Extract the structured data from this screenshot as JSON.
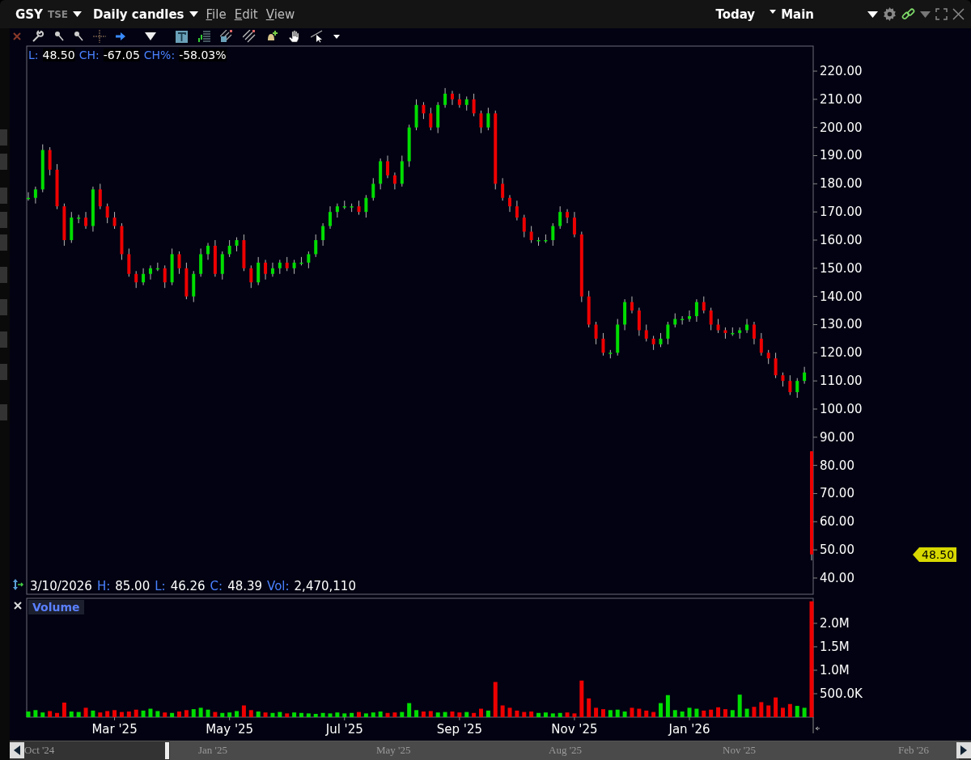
{
  "header": {
    "symbol": "GSY",
    "exchange": "TSE",
    "bar_type": "Daily candles",
    "menus": [
      "File",
      "Edit",
      "View"
    ],
    "period": "Today",
    "layout": "Main"
  },
  "price_legend": [
    {
      "label": "L:",
      "value": "48.50"
    },
    {
      "label": "CH:",
      "value": "-67.05"
    },
    {
      "label": "CH%:",
      "value": "-58.03%"
    }
  ],
  "price_chart": {
    "chart_data": {
      "type": "candlestick",
      "ylim": [
        34.24,
        228.9
      ],
      "yticks": [
        {
          "value": 40,
          "label": "40.00"
        },
        {
          "value": 50,
          "label": "50.00"
        },
        {
          "value": 60,
          "label": "60.00"
        },
        {
          "value": 70,
          "label": "70.00"
        },
        {
          "value": 80,
          "label": "80.00"
        },
        {
          "value": 90,
          "label": "90.00"
        },
        {
          "value": 100,
          "label": "100.00"
        },
        {
          "value": 110,
          "label": "110.00"
        },
        {
          "value": 120,
          "label": "120.00"
        },
        {
          "value": 130,
          "label": "130.00"
        },
        {
          "value": 140,
          "label": "140.00"
        },
        {
          "value": 150,
          "label": "150.00"
        },
        {
          "value": 160,
          "label": "160.00"
        },
        {
          "value": 170,
          "label": "170.00"
        },
        {
          "value": 180,
          "label": "180.00"
        },
        {
          "value": 190,
          "label": "190.00"
        },
        {
          "value": 200,
          "label": "200.00"
        },
        {
          "value": 210,
          "label": "210.00"
        },
        {
          "value": 220,
          "label": "220.00"
        }
      ],
      "categories": [
        null,
        null,
        null,
        null,
        null,
        null,
        null,
        null,
        null,
        null,
        null,
        null,
        null,
        null,
        null,
        null,
        null,
        null,
        null,
        null,
        null,
        null,
        null,
        null,
        null,
        null,
        null,
        null,
        null,
        null,
        null,
        null,
        null,
        null,
        null,
        null,
        null,
        null,
        null,
        null,
        null,
        null,
        null,
        null,
        null,
        null,
        null,
        null,
        null,
        null,
        null,
        null,
        null,
        null,
        null,
        null,
        null,
        null,
        null,
        null,
        null,
        null,
        null,
        null,
        null,
        null,
        null,
        null,
        null,
        null,
        null,
        null,
        null,
        null,
        null,
        null,
        null,
        null,
        null,
        null,
        null,
        null,
        null,
        null,
        null,
        null,
        null,
        null,
        null,
        null,
        null,
        null,
        null,
        null,
        null,
        null,
        null,
        null,
        null,
        null,
        null,
        null,
        null,
        null,
        null,
        null,
        null,
        null,
        null,
        null
      ],
      "ohlc": [
        [
          175,
          177,
          174,
          175
        ],
        [
          175,
          179,
          173,
          178
        ],
        [
          178,
          194,
          177,
          192
        ],
        [
          192,
          193,
          183,
          185
        ],
        [
          185,
          187,
          171,
          172
        ],
        [
          172,
          173,
          158,
          160
        ],
        [
          160,
          170,
          159,
          168
        ],
        [
          168,
          169,
          166,
          168
        ],
        [
          168,
          170,
          164,
          165
        ],
        [
          165,
          179,
          163,
          178
        ],
        [
          178,
          180,
          171,
          172
        ],
        [
          172,
          173,
          166,
          168
        ],
        [
          168,
          170,
          164,
          165
        ],
        [
          165,
          166,
          153,
          155
        ],
        [
          155,
          157,
          147,
          148
        ],
        [
          148,
          149,
          143,
          145
        ],
        [
          145,
          150,
          144,
          148
        ],
        [
          148,
          151,
          146,
          150
        ],
        [
          150,
          152,
          149,
          150
        ],
        [
          150,
          151,
          143,
          145
        ],
        [
          145,
          157,
          144,
          155
        ],
        [
          155,
          156,
          148,
          150
        ],
        [
          150,
          152,
          139,
          140
        ],
        [
          140,
          149,
          138,
          148
        ],
        [
          148,
          157,
          147,
          155
        ],
        [
          155,
          159,
          153,
          158
        ],
        [
          158,
          160,
          147,
          148
        ],
        [
          148,
          156,
          146,
          155
        ],
        [
          155,
          160,
          154,
          158
        ],
        [
          158,
          161,
          156,
          160
        ],
        [
          160,
          162,
          149,
          150
        ],
        [
          150,
          151,
          143,
          145
        ],
        [
          145,
          154,
          144,
          152
        ],
        [
          152,
          153,
          146,
          148
        ],
        [
          148,
          152,
          147,
          150
        ],
        [
          150,
          153,
          148,
          152
        ],
        [
          152,
          154,
          149,
          150
        ],
        [
          150,
          153,
          148,
          152
        ],
        [
          152,
          154,
          151,
          152
        ],
        [
          152,
          156,
          150,
          155
        ],
        [
          155,
          162,
          154,
          160
        ],
        [
          160,
          166,
          158,
          165
        ],
        [
          165,
          172,
          164,
          170
        ],
        [
          170,
          173,
          168,
          172
        ],
        [
          172,
          174,
          171,
          172
        ],
        [
          172,
          173,
          170,
          172
        ],
        [
          172,
          174,
          169,
          170
        ],
        [
          170,
          176,
          168,
          175
        ],
        [
          175,
          182,
          174,
          180
        ],
        [
          180,
          189,
          178,
          188
        ],
        [
          188,
          190,
          182,
          183
        ],
        [
          183,
          184,
          178,
          180
        ],
        [
          180,
          190,
          179,
          188
        ],
        [
          188,
          201,
          186,
          200
        ],
        [
          200,
          210,
          199,
          208
        ],
        [
          208,
          209,
          203,
          205
        ],
        [
          205,
          207,
          199,
          200
        ],
        [
          200,
          209,
          198,
          208
        ],
        [
          208,
          214,
          207,
          212
        ],
        [
          212,
          213,
          208,
          210
        ],
        [
          210,
          212,
          207,
          208
        ],
        [
          208,
          211,
          206,
          210
        ],
        [
          210,
          212,
          204,
          205
        ],
        [
          205,
          206,
          198,
          200
        ],
        [
          200,
          207,
          199,
          205
        ],
        [
          205,
          206,
          178,
          180
        ],
        [
          180,
          182,
          174,
          175
        ],
        [
          175,
          176,
          170,
          172
        ],
        [
          172,
          174,
          167,
          168
        ],
        [
          168,
          169,
          161,
          163
        ],
        [
          163,
          165,
          159,
          160
        ],
        [
          160,
          161,
          158,
          160
        ],
        [
          160,
          162,
          159,
          160
        ],
        [
          160,
          166,
          158,
          165
        ],
        [
          165,
          172,
          164,
          170
        ],
        [
          170,
          171,
          166,
          168
        ],
        [
          168,
          170,
          161,
          162
        ],
        [
          162,
          163,
          138,
          140
        ],
        [
          140,
          142,
          129,
          130
        ],
        [
          130,
          131,
          123,
          125
        ],
        [
          125,
          127,
          119,
          120
        ],
        [
          120,
          121,
          118,
          120
        ],
        [
          120,
          132,
          119,
          130
        ],
        [
          130,
          139,
          128,
          138
        ],
        [
          138,
          140,
          134,
          135
        ],
        [
          135,
          136,
          126,
          128
        ],
        [
          128,
          130,
          124,
          125
        ],
        [
          125,
          126,
          121,
          123
        ],
        [
          123,
          127,
          122,
          125
        ],
        [
          125,
          131,
          123,
          130
        ],
        [
          130,
          134,
          129,
          132
        ],
        [
          132,
          133,
          130,
          132
        ],
        [
          132,
          135,
          131,
          133
        ],
        [
          133,
          139,
          131,
          138
        ],
        [
          138,
          140,
          134,
          135
        ],
        [
          135,
          136,
          128,
          130
        ],
        [
          130,
          132,
          127,
          128
        ],
        [
          128,
          129,
          125,
          127
        ],
        [
          127,
          129,
          126,
          127
        ],
        [
          127,
          129,
          125,
          128
        ],
        [
          128,
          132,
          127,
          130
        ],
        [
          130,
          131,
          123,
          125
        ],
        [
          125,
          127,
          119,
          120
        ],
        [
          120,
          121,
          116,
          118
        ],
        [
          118,
          120,
          111,
          112
        ],
        [
          112,
          113,
          108,
          110
        ],
        [
          110,
          112,
          105,
          106
        ],
        [
          106,
          111,
          104,
          110
        ],
        [
          110,
          115,
          109,
          113
        ],
        [
          85,
          85,
          46.26,
          48.39
        ]
      ]
    },
    "last_price": "48.50"
  },
  "bar_legend": {
    "date": "3/10/2026",
    "fields": [
      {
        "label": "H:",
        "value": "85.00"
      },
      {
        "label": "L:",
        "value": "46.26"
      },
      {
        "label": "C:",
        "value": "48.39"
      },
      {
        "label": "Vol:",
        "value": "2,470,110"
      }
    ]
  },
  "volume_chart": {
    "chart_data": {
      "type": "bar",
      "ylim": [
        0,
        2534000
      ],
      "yticks": [
        {
          "value": 500000,
          "label": "500.0K"
        },
        {
          "value": 1000000,
          "label": "1.0M"
        },
        {
          "value": 1500000,
          "label": "1.5M"
        },
        {
          "value": 2000000,
          "label": "2.0M"
        }
      ],
      "categories": [
        null,
        null,
        null,
        null,
        null,
        null,
        null,
        null,
        null,
        null,
        null,
        null,
        "Mar '25",
        null,
        null,
        null,
        null,
        null,
        null,
        null,
        null,
        null,
        null,
        null,
        null,
        null,
        null,
        null,
        "May '25",
        null,
        null,
        null,
        null,
        null,
        null,
        null,
        null,
        null,
        null,
        null,
        null,
        null,
        null,
        null,
        "Jul '25",
        null,
        null,
        null,
        null,
        null,
        null,
        null,
        null,
        null,
        null,
        null,
        null,
        null,
        null,
        null,
        "Sep '25",
        null,
        null,
        null,
        null,
        null,
        null,
        null,
        null,
        null,
        null,
        null,
        null,
        null,
        null,
        null,
        "Nov '25",
        null,
        null,
        null,
        null,
        null,
        null,
        null,
        null,
        null,
        null,
        null,
        null,
        null,
        null,
        null,
        "Jan '26",
        null,
        null,
        null,
        null,
        null,
        null,
        null,
        null,
        null,
        null,
        null,
        null,
        null,
        null,
        null,
        null,
        null
      ],
      "series": [
        {
          "name": "Volume",
          "values": [
            120000,
            150000,
            100000,
            130000,
            90000,
            310000,
            120000,
            110000,
            200000,
            140000,
            100000,
            130000,
            150000,
            110000,
            120000,
            160000,
            140000,
            180000,
            130000,
            100000,
            90000,
            120000,
            150000,
            170000,
            200000,
            160000,
            110000,
            90000,
            100000,
            130000,
            250000,
            150000,
            120000,
            100000,
            90000,
            110000,
            80000,
            100000,
            90000,
            80000,
            70000,
            90000,
            80000,
            100000,
            80000,
            90000,
            110000,
            80000,
            100000,
            120000,
            90000,
            100000,
            110000,
            300000,
            150000,
            120000,
            130000,
            100000,
            110000,
            120000,
            100000,
            110000,
            90000,
            180000,
            140000,
            750000,
            250000,
            200000,
            140000,
            110000,
            120000,
            90000,
            100000,
            80000,
            90000,
            100000,
            80000,
            780000,
            400000,
            200000,
            170000,
            150000,
            160000,
            120000,
            200000,
            180000,
            140000,
            110000,
            300000,
            470000,
            150000,
            120000,
            200000,
            180000,
            140000,
            160000,
            210000,
            170000,
            150000,
            480000,
            180000,
            220000,
            320000,
            250000,
            420000,
            200000,
            280000,
            240000,
            200000,
            2470110
          ]
        }
      ]
    }
  },
  "navigator": {
    "labels": [
      "Oct '24",
      "Jan '25",
      "May '25",
      "Aug '25",
      "Nov '25",
      "Feb '26"
    ]
  }
}
